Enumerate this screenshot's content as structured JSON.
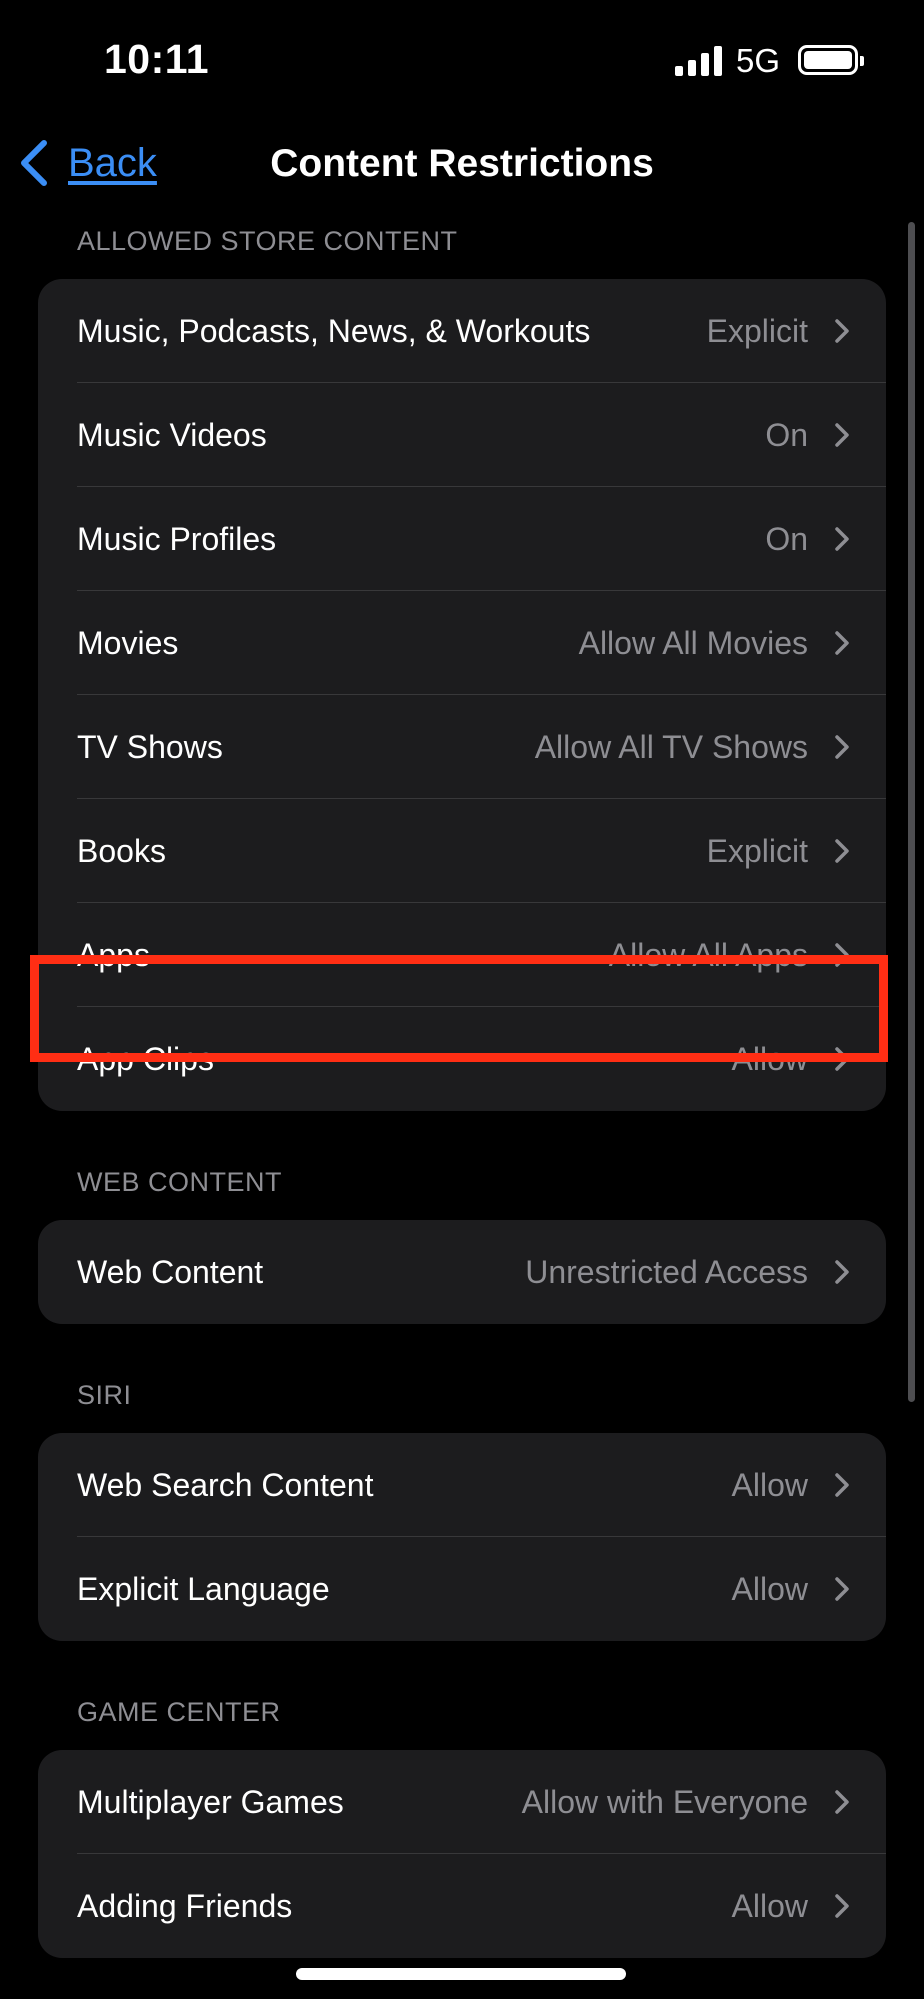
{
  "status_bar": {
    "time": "10:11",
    "network": "5G"
  },
  "nav": {
    "back_label": "Back",
    "title": "Content Restrictions"
  },
  "sections": [
    {
      "header": "ALLOWED STORE CONTENT",
      "rows": [
        {
          "label": "Music, Podcasts, News, & Workouts",
          "value": "Explicit"
        },
        {
          "label": "Music Videos",
          "value": "On"
        },
        {
          "label": "Music Profiles",
          "value": "On"
        },
        {
          "label": "Movies",
          "value": "Allow All Movies"
        },
        {
          "label": "TV Shows",
          "value": "Allow All TV Shows"
        },
        {
          "label": "Books",
          "value": "Explicit"
        },
        {
          "label": "Apps",
          "value": "Allow All Apps"
        },
        {
          "label": "App Clips",
          "value": "Allow"
        }
      ]
    },
    {
      "header": "WEB CONTENT",
      "rows": [
        {
          "label": "Web Content",
          "value": "Unrestricted Access"
        }
      ]
    },
    {
      "header": "SIRI",
      "rows": [
        {
          "label": "Web Search Content",
          "value": "Allow"
        },
        {
          "label": "Explicit Language",
          "value": "Allow"
        }
      ]
    },
    {
      "header": "GAME CENTER",
      "rows": [
        {
          "label": "Multiplayer Games",
          "value": "Allow with Everyone"
        },
        {
          "label": "Adding Friends",
          "value": "Allow"
        }
      ]
    }
  ],
  "colors": {
    "accent": "#3b8ef5",
    "highlight": "#ff2e14",
    "group_bg": "#1c1c1e"
  }
}
